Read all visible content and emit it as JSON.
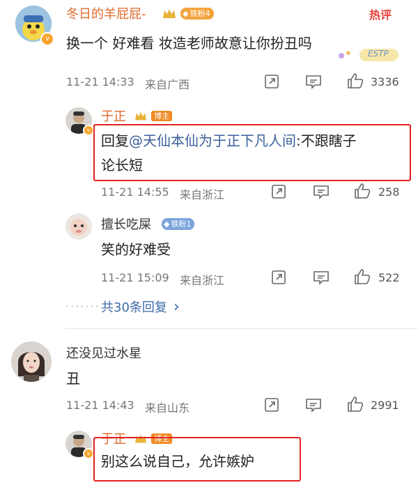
{
  "hot_tag": "热评",
  "comment1": {
    "username": "冬日的羊屁屁-",
    "fan_badge": "铁粉4",
    "text": "换一个 好难看 妆造老师故意让你扮丑吗",
    "timestamp": "11-21 14:33",
    "location": "来自广西",
    "likes": "3336",
    "deco_text": "ESTP"
  },
  "reply1": {
    "username": "于正",
    "host_badge": "博主",
    "prefix": "回复",
    "mention": "@天仙本仙为于正下凡人间",
    "text_line1_tail": ":不跟瞎子",
    "text_line2": "论长短",
    "timestamp": "11-21 14:55",
    "location": "来自浙江",
    "likes": "258"
  },
  "reply2": {
    "username": "擅长吃屎",
    "fan_badge": "铁粉1",
    "text": "笑的好难受",
    "timestamp": "11-21 15:09",
    "location": "来自浙江",
    "likes": "522"
  },
  "more_replies": {
    "dots": "·······",
    "label": "共30条回复",
    "chevron": "›"
  },
  "comment2": {
    "username": "还没见过水星",
    "text": "丑",
    "timestamp": "11-21 14:43",
    "location": "来自山东",
    "likes": "2991"
  },
  "reply3": {
    "username": "于正",
    "host_badge": "博主",
    "text": "别这么说自己，允许嫉妒"
  },
  "icons": [
    "share-icon",
    "comment-icon",
    "like-icon",
    "fan-diamond-icon",
    "crown-icon"
  ],
  "colors": {
    "username": "#e06a2b",
    "mention": "#3a5f9c",
    "highlight_box": "#e02020",
    "hot_tag": "#e8413b"
  }
}
